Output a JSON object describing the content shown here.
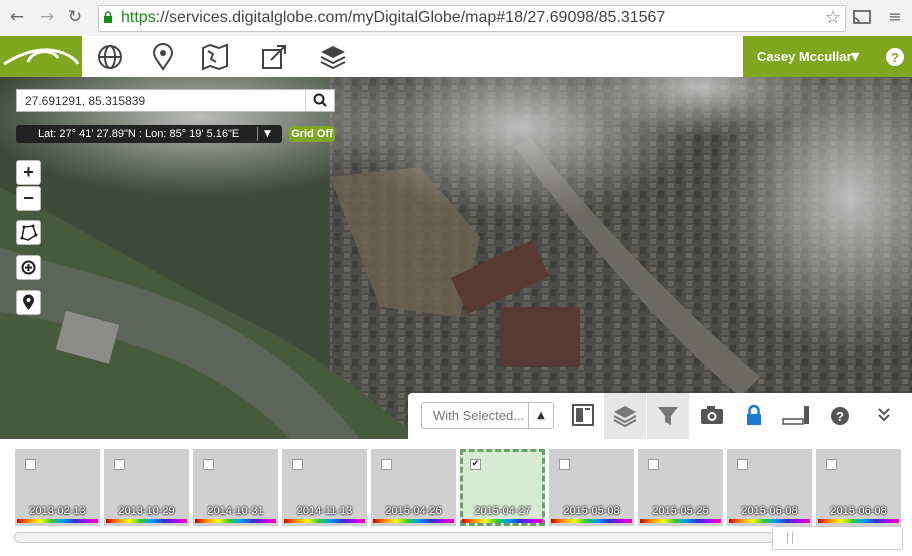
{
  "browser": {
    "url_scheme": "https",
    "url_rest": "://services.digitalglobe.com/myDigitalGlobe/map#18/27.69098/85.31567"
  },
  "appbar": {
    "tools": [
      "globe-icon",
      "map-pin-icon",
      "map-fold-icon",
      "share-external-icon",
      "layers-icon"
    ],
    "user_name": "Casey Mccullar",
    "user_caret": "▼",
    "help_label": "?"
  },
  "map": {
    "coordinate_input_value": "27.691291, 85.315839",
    "latlon_readout": "Lat: 27° 41' 27.89\"N : Lon: 85° 19' 5.16\"E",
    "latlon_caret": "▼",
    "grid_toggle_label": "Grid Off",
    "zoom_in_label": "+",
    "zoom_out_label": "−"
  },
  "panel": {
    "with_selected_label": "With Selected...",
    "with_selected_caret": "▲",
    "buttons": [
      "contact-card-icon",
      "layers-icon",
      "filter-icon",
      "camera-icon",
      "lock-icon",
      "signal-bars-icon",
      "help-icon",
      "collapse-icon"
    ]
  },
  "thumbnails": [
    {
      "date": "2013-02-13",
      "checked": false
    },
    {
      "date": "2013-10-29",
      "checked": false
    },
    {
      "date": "2014-10-31",
      "checked": false
    },
    {
      "date": "2014-11-13",
      "checked": false
    },
    {
      "date": "2015-04-26",
      "checked": false
    },
    {
      "date": "2015-04-27",
      "checked": true
    },
    {
      "date": "2015-05-08",
      "checked": false
    },
    {
      "date": "2015-05-25",
      "checked": false
    },
    {
      "date": "2015-06-08",
      "checked": false
    },
    {
      "date": "2015-06-08",
      "checked": false
    }
  ],
  "colors": {
    "brand_green": "#7fa61e",
    "selected_thumb_bg": "#d7ead3",
    "lock_blue": "#1a7bd1"
  }
}
